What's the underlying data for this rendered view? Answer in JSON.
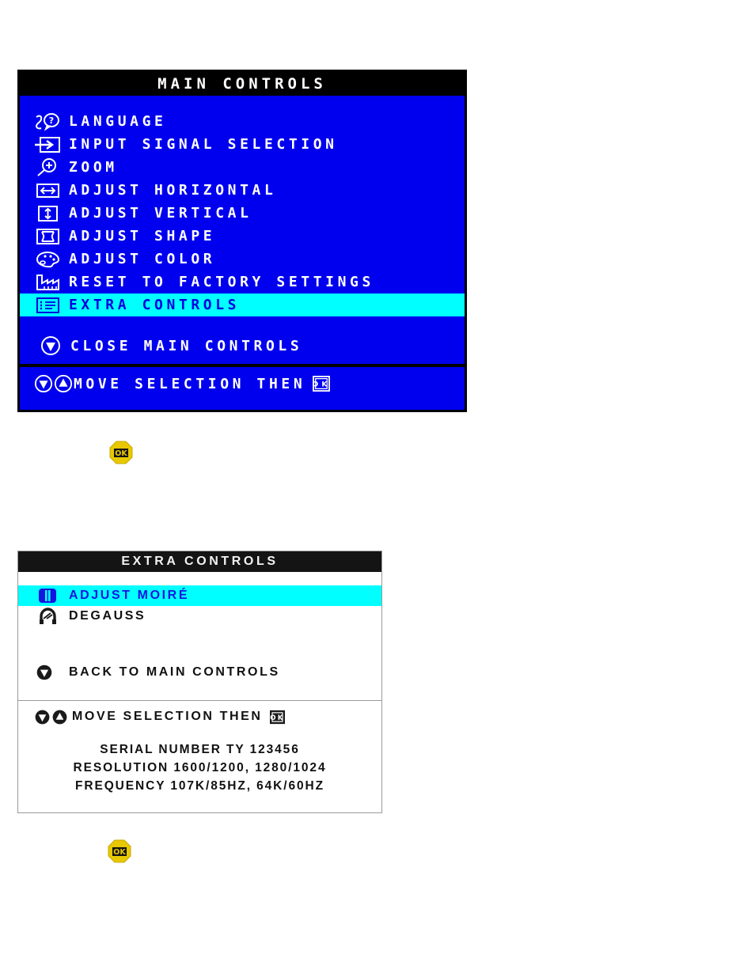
{
  "main_controls": {
    "title": "MAIN CONTROLS",
    "items": [
      {
        "icon": "language-icon",
        "label": "LANGUAGE",
        "selected": false
      },
      {
        "icon": "input-signal-icon",
        "label": "INPUT SIGNAL SELECTION",
        "selected": false
      },
      {
        "icon": "zoom-icon",
        "label": "ZOOM",
        "selected": false
      },
      {
        "icon": "adjust-horizontal-icon",
        "label": "ADJUST HORIZONTAL",
        "selected": false
      },
      {
        "icon": "adjust-vertical-icon",
        "label": "ADJUST VERTICAL",
        "selected": false
      },
      {
        "icon": "adjust-shape-icon",
        "label": "ADJUST SHAPE",
        "selected": false
      },
      {
        "icon": "adjust-color-icon",
        "label": "ADJUST COLOR",
        "selected": false
      },
      {
        "icon": "factory-reset-icon",
        "label": "RESET TO FACTORY SETTINGS",
        "selected": false
      },
      {
        "icon": "extra-controls-icon",
        "label": "EXTRA CONTROLS",
        "selected": true
      }
    ],
    "close_item": {
      "icon": "close-down-icon",
      "label": "CLOSE MAIN CONTROLS"
    },
    "footer": {
      "label": "MOVE SELECTION THEN",
      "ok_icon": "ok-key-icon"
    },
    "colors": {
      "background": "#0000ee",
      "titlebar": "#000000",
      "text": "#ffffff",
      "highlight": "#00ffff",
      "highlight_text": "#0000dd"
    }
  },
  "extra_controls": {
    "title": "EXTRA CONTROLS",
    "items": [
      {
        "icon": "moire-icon",
        "label": "ADJUST MOIRÉ",
        "selected": true
      },
      {
        "icon": "degauss-icon",
        "label": "DEGAUSS",
        "selected": false
      }
    ],
    "back_item": {
      "icon": "back-down-icon",
      "label": "BACK TO MAIN CONTROLS"
    },
    "footer": {
      "label": "MOVE SELECTION THEN",
      "ok_icon": "ok-key-icon"
    },
    "info_lines": [
      "SERIAL NUMBER TY 123456",
      "RESOLUTION 1600/1200, 1280/1024",
      "FREQUENCY 107K/85HZ, 64K/60HZ"
    ],
    "colors": {
      "background": "#ffffff",
      "titlebar": "#141414",
      "text": "#111111",
      "highlight": "#00ffff",
      "highlight_text": "#1414e0"
    }
  },
  "ok_badges": [
    {
      "name": "ok-badge-after-main",
      "label": "OK",
      "color": "#e8c800"
    },
    {
      "name": "ok-badge-after-extra",
      "label": "OK",
      "color": "#e8c800"
    }
  ]
}
